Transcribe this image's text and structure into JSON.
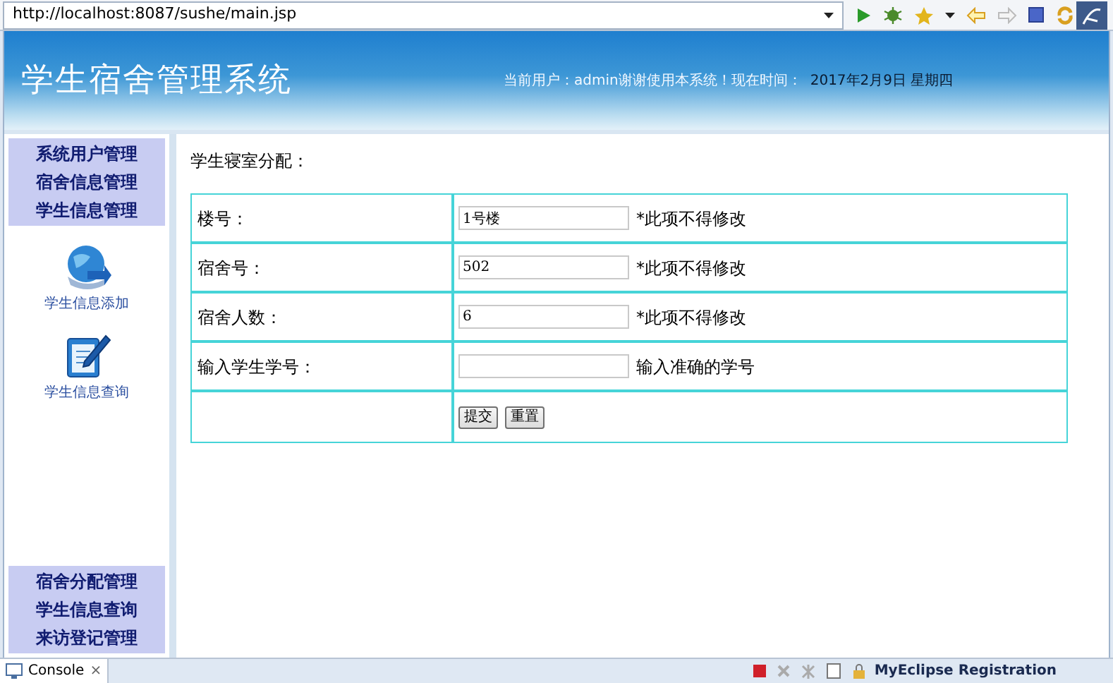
{
  "browser": {
    "url": "http://localhost:8087/sushe/main.jsp"
  },
  "header": {
    "title": "学生宿舍管理系统",
    "user_info": "当前用户：admin谢谢使用本系统！现在时间：",
    "date": "2017年2月9日  星期四"
  },
  "sidebar": {
    "top_menu": [
      "系统用户管理",
      "宿舍信息管理",
      "学生信息管理"
    ],
    "shortcuts": [
      {
        "label": "学生信息添加",
        "kind": "globe"
      },
      {
        "label": "学生信息查询",
        "kind": "notepad"
      }
    ],
    "bottom_menu": [
      "宿舍分配管理",
      "学生信息查询",
      "来访登记管理"
    ]
  },
  "form": {
    "title": "学生寝室分配：",
    "rows": [
      {
        "label": "楼号：",
        "value": "1号楼",
        "note": "*此项不得修改"
      },
      {
        "label": "宿舍号：",
        "value": "502",
        "note": "*此项不得修改"
      },
      {
        "label": "宿舍人数：",
        "value": "6",
        "note": "*此项不得修改"
      },
      {
        "label": "输入学生学号：",
        "value": "",
        "note": "输入准确的学号"
      }
    ],
    "buttons": [
      "提交",
      "重置"
    ]
  },
  "console": {
    "tab": "Console",
    "close": "×",
    "registration": "MyEclipse Registration"
  }
}
